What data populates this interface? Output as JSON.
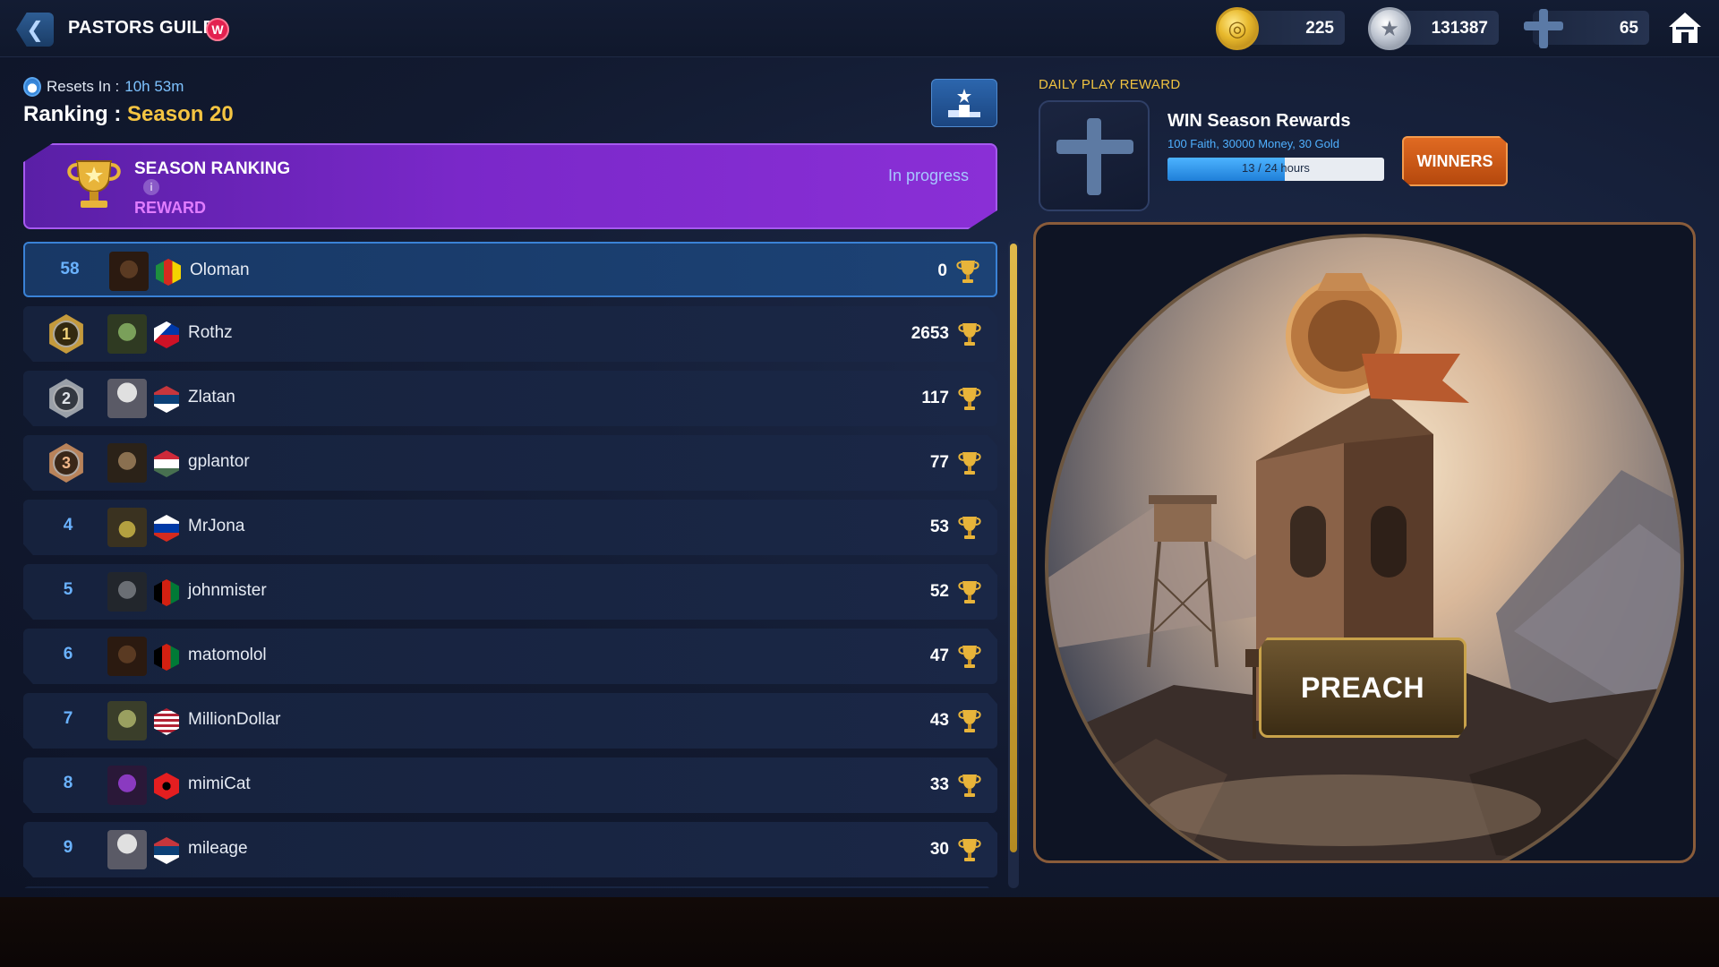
{
  "header": {
    "title": "PASTORS GUILD -",
    "badge": "W",
    "currencies": [
      {
        "icon": "gold-coin-icon",
        "value": "225"
      },
      {
        "icon": "silver-coin-icon",
        "value": "131387"
      },
      {
        "icon": "cross-icon",
        "value": "65"
      }
    ]
  },
  "left": {
    "resets_label": "Resets In :",
    "resets_time": "10h 53m",
    "ranking_label": "Ranking :",
    "season": "Season 20",
    "banner": {
      "title": "SEASON RANKING",
      "info": "i",
      "reward": "REWARD",
      "status": "In progress"
    },
    "rows": [
      {
        "rank": "58",
        "medal": "",
        "name": "Oloman",
        "score": "0",
        "me": true,
        "flag": "cameroon",
        "avatar": "gasmask"
      },
      {
        "rank": "1",
        "medal": "gold",
        "name": "Rothz",
        "score": "2653",
        "me": false,
        "flag": "philippines",
        "avatar": "zombie"
      },
      {
        "rank": "2",
        "medal": "silver",
        "name": "Zlatan",
        "score": "117",
        "me": false,
        "flag": "serbia",
        "avatar": "nurse"
      },
      {
        "rank": "3",
        "medal": "bronze",
        "name": "gplantor",
        "score": "77",
        "me": false,
        "flag": "hungary",
        "avatar": "hermit"
      },
      {
        "rank": "4",
        "medal": "",
        "name": "MrJona",
        "score": "53",
        "me": false,
        "flag": "russia",
        "avatar": "cowboy"
      },
      {
        "rank": "5",
        "medal": "",
        "name": "johnmister",
        "score": "52",
        "me": false,
        "flag": "afghanistan",
        "avatar": "soldier"
      },
      {
        "rank": "6",
        "medal": "",
        "name": "matomolol",
        "score": "47",
        "me": false,
        "flag": "afghanistan",
        "avatar": "gasmask"
      },
      {
        "rank": "7",
        "medal": "",
        "name": "MillionDollar",
        "score": "43",
        "me": false,
        "flag": "usa",
        "avatar": "hazmat"
      },
      {
        "rank": "8",
        "medal": "",
        "name": "mimiCat",
        "score": "33",
        "me": false,
        "flag": "albania",
        "avatar": "purple"
      },
      {
        "rank": "9",
        "medal": "",
        "name": "mileage",
        "score": "30",
        "me": false,
        "flag": "serbia",
        "avatar": "nurse"
      }
    ]
  },
  "right": {
    "daily_label": "DAILY PLAY REWARD",
    "win_title": "WIN Season Rewards",
    "win_desc": "100 Faith, 30000 Money, 30 Gold",
    "progress_text": "13 / 24 hours",
    "progress_fraction": 0.5417,
    "winners_label": "WINNERS",
    "preach_label": "PREACH"
  },
  "colors": {
    "accent_gold": "#f5c542",
    "accent_blue": "#6ab2ff",
    "banner_purple": "#7a28c9",
    "winners_orange": "#e06a22"
  }
}
